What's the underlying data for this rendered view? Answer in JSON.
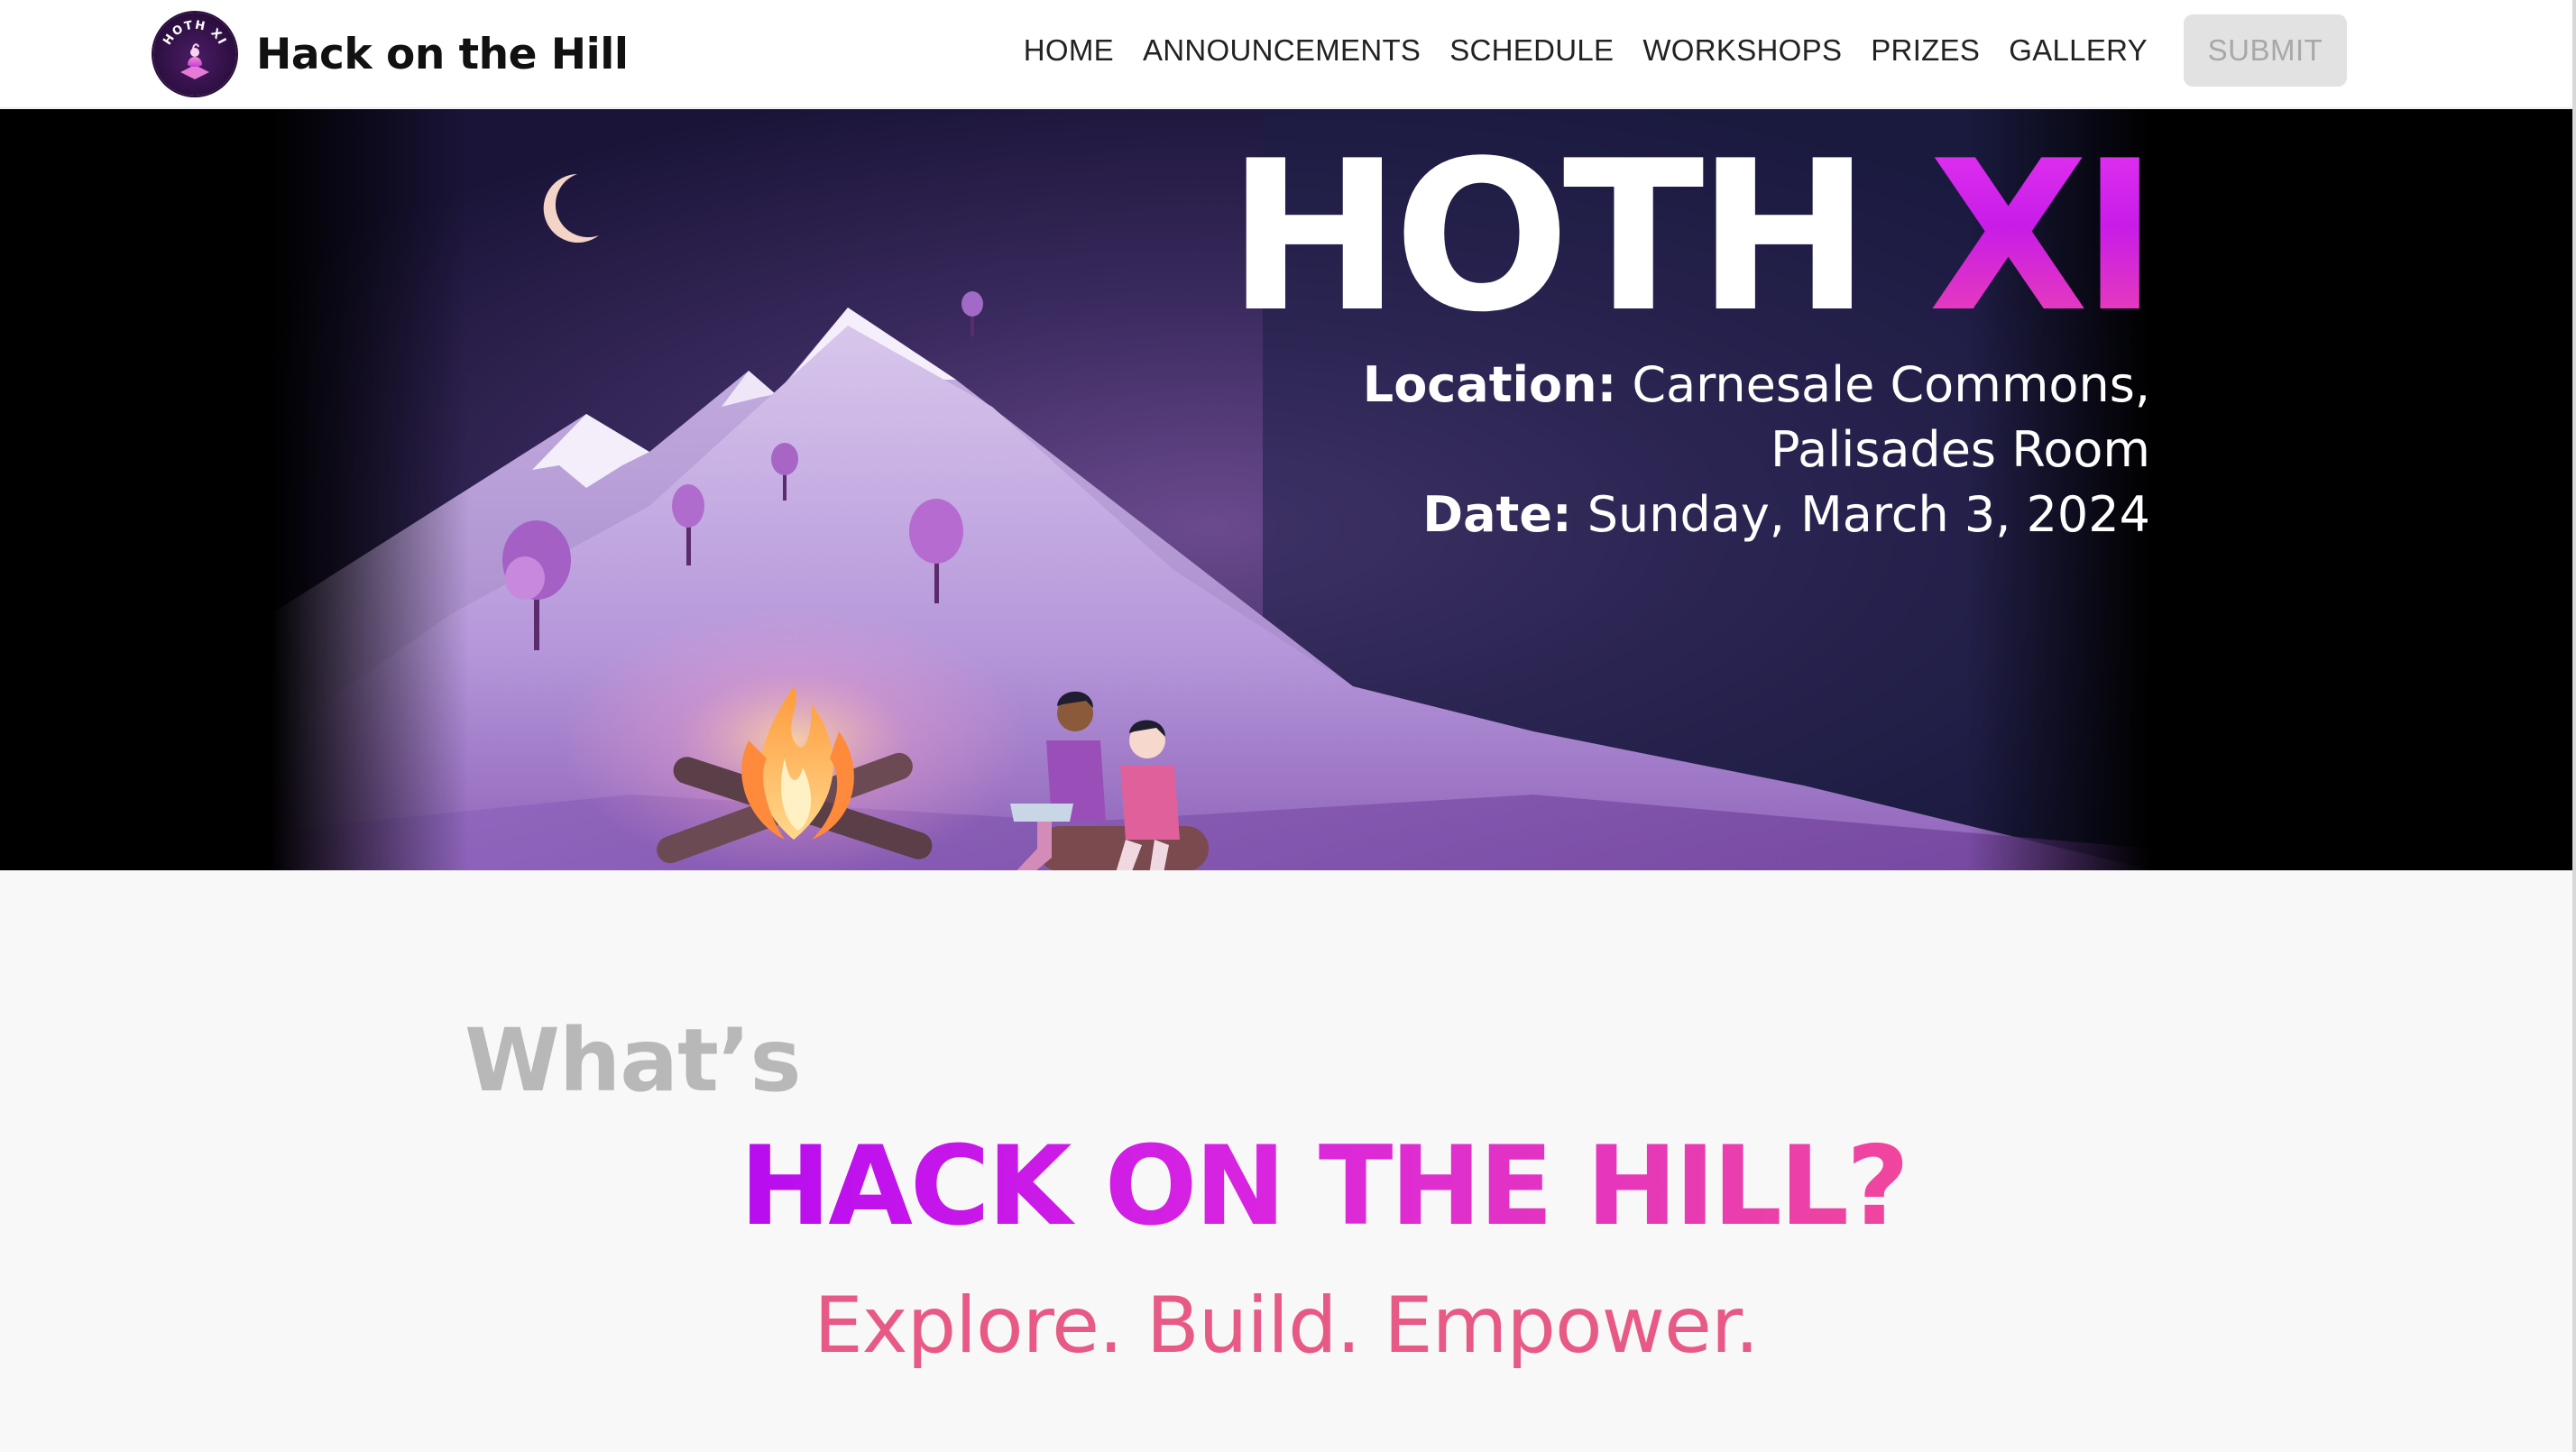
{
  "brand": {
    "name": "Hack on the Hill",
    "logo_text": "HOTH XI"
  },
  "nav": {
    "items": [
      "HOME",
      "ANNOUNCEMENTS",
      "SCHEDULE",
      "WORKSHOPS",
      "PRIZES",
      "GALLERY"
    ],
    "submit_label": "SUBMIT"
  },
  "hero": {
    "title_main": "HOTH ",
    "title_accent": "XI",
    "location_label": "Location:",
    "location_line1": " Carnesale Commons,",
    "location_line2": "Palisades Room",
    "date_label": "Date:",
    "date_value": " Sunday, March 3, 2024"
  },
  "about": {
    "prefix": "What’s",
    "heading": "HACK ON THE HILL?",
    "tagline": "Explore. Build. Empower."
  },
  "colors": {
    "accent_pink": "#e85a86",
    "accent_magenta": "#c81ce8",
    "submit_bg": "#e2e2e2"
  }
}
